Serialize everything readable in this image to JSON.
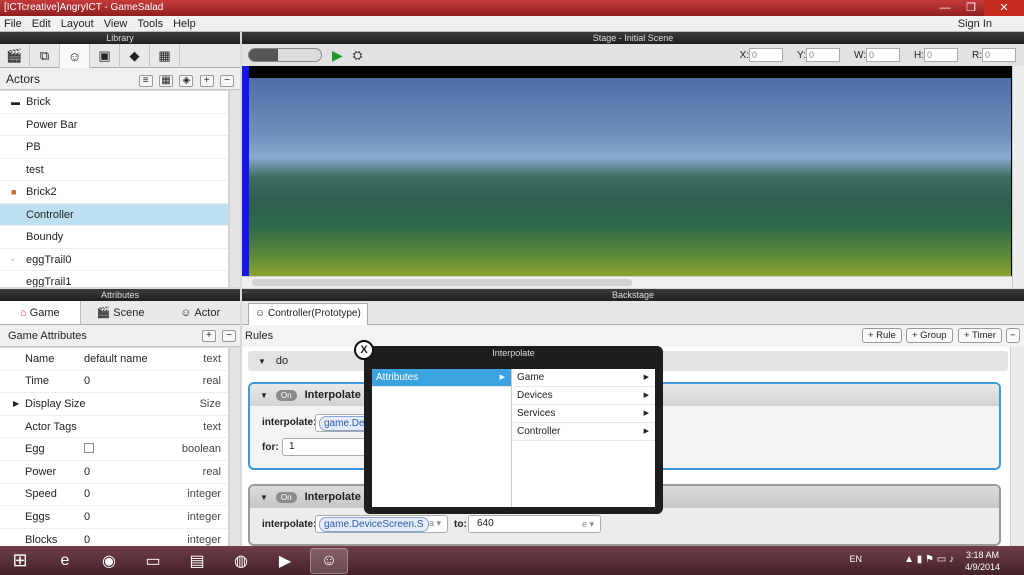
{
  "window": {
    "title": "[ICTcreative]AngryICT - GameSalad",
    "min": "—",
    "max": "❐",
    "close": "✕"
  },
  "menu": {
    "items": [
      "File",
      "Edit",
      "Layout",
      "View",
      "Tools",
      "Help"
    ],
    "signin": "Sign In"
  },
  "library": {
    "header": "Library",
    "actors_label": "Actors",
    "actors": [
      {
        "name": "Brick",
        "glyph": "▬"
      },
      {
        "name": "Power Bar",
        "glyph": ""
      },
      {
        "name": "PB",
        "glyph": ""
      },
      {
        "name": "test",
        "glyph": ""
      },
      {
        "name": "Brick2",
        "glyph": "■"
      },
      {
        "name": "Controller",
        "glyph": ""
      },
      {
        "name": "Boundy",
        "glyph": ""
      },
      {
        "name": "eggTrail0",
        "glyph": "•"
      },
      {
        "name": "eggTrail1",
        "glyph": ""
      }
    ]
  },
  "stage": {
    "header": "Stage - Initial Scene",
    "coords": [
      {
        "label": "X:",
        "value": "0"
      },
      {
        "label": "Y:",
        "value": "0"
      },
      {
        "label": "W:",
        "value": "0"
      },
      {
        "label": "H:",
        "value": "0"
      },
      {
        "label": "R:",
        "value": "0"
      }
    ]
  },
  "attributes": {
    "header": "Attributes",
    "tabs": [
      "Game",
      "Scene",
      "Actor"
    ],
    "section_title": "Game Attributes",
    "rows": [
      {
        "name": "Name",
        "value": "default name",
        "type": "text"
      },
      {
        "name": "Time",
        "value": "0",
        "type": "real"
      },
      {
        "name": "Display Size",
        "value": "",
        "type": "Size"
      },
      {
        "name": "Actor Tags",
        "value": "",
        "type": "text"
      },
      {
        "name": "Egg",
        "value": "",
        "type": "boolean"
      },
      {
        "name": "Power",
        "value": "0",
        "type": "real"
      },
      {
        "name": "Speed",
        "value": "0",
        "type": "integer"
      },
      {
        "name": "Eggs",
        "value": "0",
        "type": "integer"
      },
      {
        "name": "Blocks",
        "value": "0",
        "type": "integer"
      }
    ]
  },
  "backstage": {
    "header": "Backstage",
    "tab_label": "Controller(Prototype)",
    "rules_label": "Rules",
    "buttons": [
      "+ Rule",
      "+ Group",
      "+ Timer"
    ],
    "do_label": "do",
    "block1": {
      "on": "On",
      "title": "Interpolate",
      "interpolate_label": "interpolate:",
      "token": "game.Devi",
      "for_label": "for:",
      "for_value": "1"
    },
    "block2": {
      "on": "On",
      "title": "Interpolate",
      "interpolate_label": "interpolate:",
      "token": "game.DeviceScreen.S",
      "to_label": "to:",
      "to_value": "640"
    }
  },
  "popup": {
    "title": "Interpolate",
    "col1": [
      "Attributes"
    ],
    "col2": [
      "Game",
      "Devices",
      "Services",
      "Controller"
    ],
    "close": "X"
  },
  "taskbar": {
    "lang": "EN",
    "time": "3:18 AM",
    "date": "4/9/2014"
  }
}
